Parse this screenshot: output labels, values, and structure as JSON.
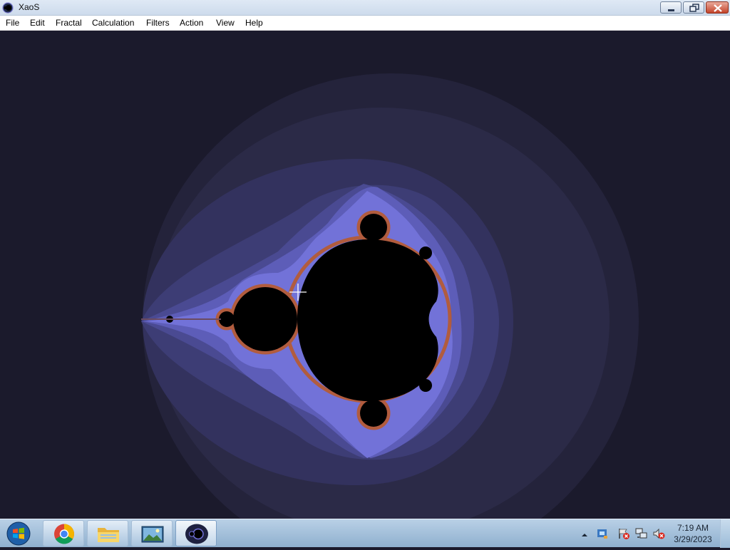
{
  "window": {
    "title": "XaoS"
  },
  "menu": {
    "file": "File",
    "edit": "Edit",
    "fractal": "Fractal",
    "calculation": "Calculation",
    "filters": "Filters",
    "action": "Action",
    "view": "View",
    "help": "Help"
  },
  "canvas": {
    "background": "#1b1a2c",
    "set_color": "#000000",
    "band_colors": [
      "#24233b",
      "#2f2e52",
      "#38386a",
      "#444486",
      "#5656a8",
      "#6f6fd0",
      "#8a8ae8"
    ],
    "edge_color": "#b85a2e"
  },
  "taskbar": {
    "apps": [
      {
        "name": "Google Chrome",
        "icon": "chrome-icon"
      },
      {
        "name": "File Explorer",
        "icon": "folder-icon"
      },
      {
        "name": "Pictures",
        "icon": "pictures-icon"
      },
      {
        "name": "XaoS",
        "icon": "xaos-icon"
      }
    ],
    "clock": {
      "time": "7:19 AM",
      "date": "3/29/2023"
    }
  }
}
